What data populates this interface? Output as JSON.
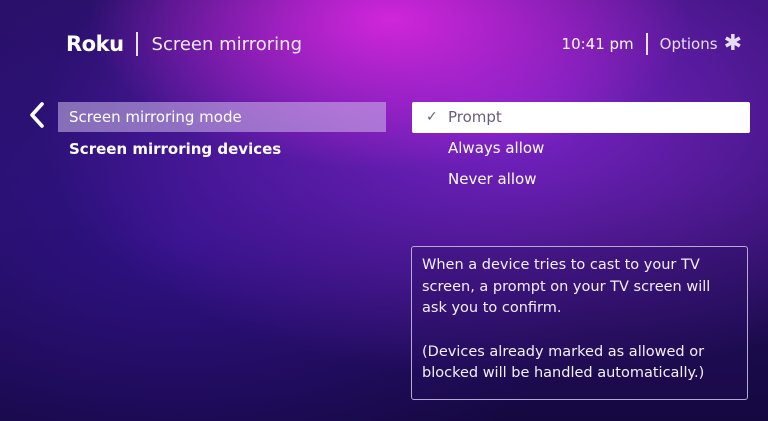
{
  "header": {
    "logo": "Roku",
    "title": "Screen mirroring",
    "time": "10:41 pm",
    "options_label": "Options",
    "options_icon": "asterisk-icon"
  },
  "nav": {
    "back_icon": "chevron-left-icon"
  },
  "menu": {
    "items": [
      {
        "label": "Screen mirroring mode",
        "selected": true
      },
      {
        "label": "Screen mirroring devices",
        "selected": false
      }
    ]
  },
  "mode_options": {
    "items": [
      {
        "label": "Prompt",
        "checked": true,
        "focused": true
      },
      {
        "label": "Always allow",
        "checked": false
      },
      {
        "label": "Never allow",
        "checked": false
      }
    ],
    "check_icon": "checkmark-icon"
  },
  "info": {
    "paragraph1": "When a device tries to cast to your TV screen, a prompt on your TV screen will ask you to confirm.",
    "paragraph2": "(Devices already marked as allowed or blocked will be handled automatically.)"
  },
  "colors": {
    "background": "#241060",
    "accent_glow": "#e628e6",
    "focus_highlight": "#ffffff",
    "selected_menu": "#cdb9eb"
  }
}
